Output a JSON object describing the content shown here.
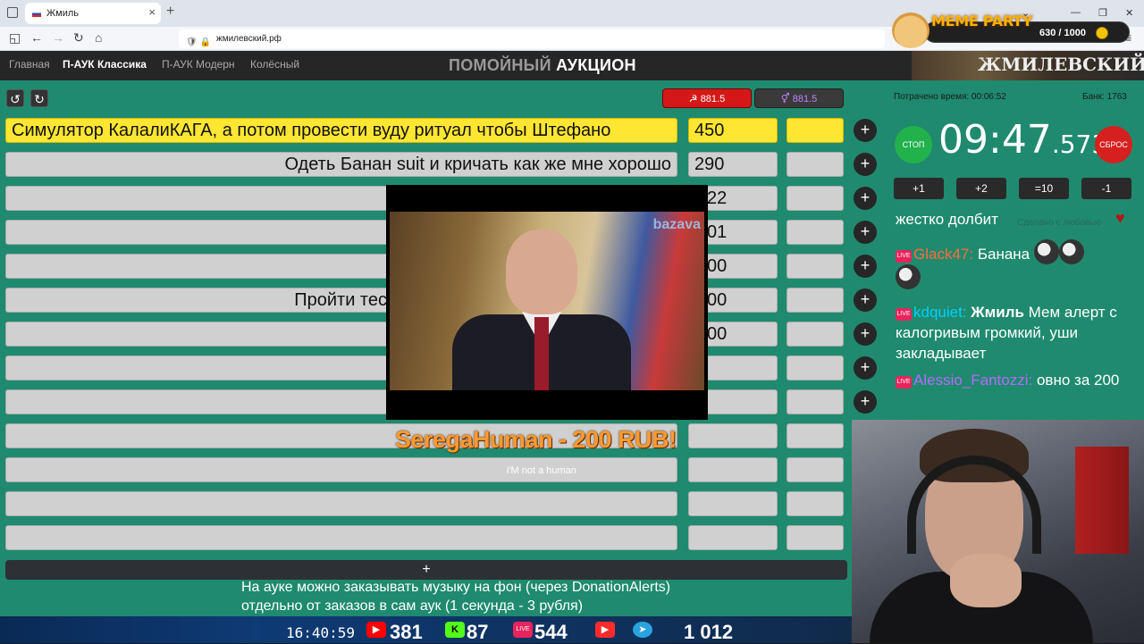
{
  "browser": {
    "tab_title": "Жмиль",
    "url": "жмилевский.рф"
  },
  "meme_party": {
    "logo": "MEME PARTY",
    "count": "630 / 1000"
  },
  "nav": {
    "links": [
      "Главная",
      "П-АУК Классика",
      "П-АУК Модерн",
      "Колёсный"
    ],
    "title_dim": "ПОМОЙНЫЙ",
    "title_main": "АУКЦИОН",
    "banner": "ЖМИЛЕВСКИЙ.РФ"
  },
  "totals": {
    "red": "881.5",
    "purple": "881.5"
  },
  "lots": [
    {
      "name": "Симулятор КалалиКАГА, а потом провести вуду ритуал чтобы Штефано",
      "amount": "450",
      "leader": true
    },
    {
      "name": "Одеть Банан suit и кричать как же мне хорошо",
      "amount": "290",
      "leader": false
    },
    {
      "name": "",
      "amount": "22",
      "leader": false
    },
    {
      "name": "",
      "amount": "01",
      "leader": false
    },
    {
      "name": "",
      "amount": "00",
      "leader": false
    },
    {
      "name": "Пройти тес",
      "amount": "00",
      "leader": false
    },
    {
      "name": "",
      "amount": "00",
      "leader": false
    },
    {
      "name": "",
      "amount": "",
      "leader": false
    },
    {
      "name": "",
      "amount": "",
      "leader": false
    },
    {
      "name": "",
      "amount": "",
      "leader": false
    },
    {
      "name": "",
      "amount": "",
      "leader": false
    },
    {
      "name": "",
      "amount": "",
      "leader": false
    },
    {
      "name": "",
      "amount": "",
      "leader": false
    }
  ],
  "add_lot": "+",
  "video": {
    "watermark": "bazava"
  },
  "donation": {
    "text": "SeregaHuman - 200 RUB!",
    "message": "i'M not a human"
  },
  "info": {
    "line1": "На ауке можно заказывать музыку на фон (через DonationAlerts)",
    "line2": "отдельно от заказов в сам аук (1 секунда - 3 рубля)"
  },
  "stats": {
    "elapsed": "Потрачено время: 00:06:52",
    "bank": "Банк: 1763"
  },
  "timer": {
    "stop": "СТОП",
    "reset": "СБРОС",
    "main": "09:47",
    "ms": ".573",
    "buttons": [
      "+1",
      "+2",
      "=10",
      "-1"
    ]
  },
  "chat": {
    "top_line": "жестко долбит",
    "credit": "Сделано с любовью",
    "messages": [
      {
        "nick": "Glack47:",
        "text": "Банана"
      },
      {
        "nick": "kdquiet:",
        "bold": "Жмиль",
        "text": "Мем алерт с калогривым громкий, уши закладывает"
      },
      {
        "nick": "Alessio_Fantozzi:",
        "text": "овно за 200"
      }
    ]
  },
  "streambar": {
    "clock": "16:40:59",
    "youtube": "381",
    "kick": "87",
    "live": "544",
    "telegram": "1 012"
  },
  "colors": {
    "page_bg": "#1f8a6e",
    "leader": "#ffe633",
    "stop": "#22b24c",
    "reset": "#d62020",
    "donation": "#ff9a2e"
  }
}
